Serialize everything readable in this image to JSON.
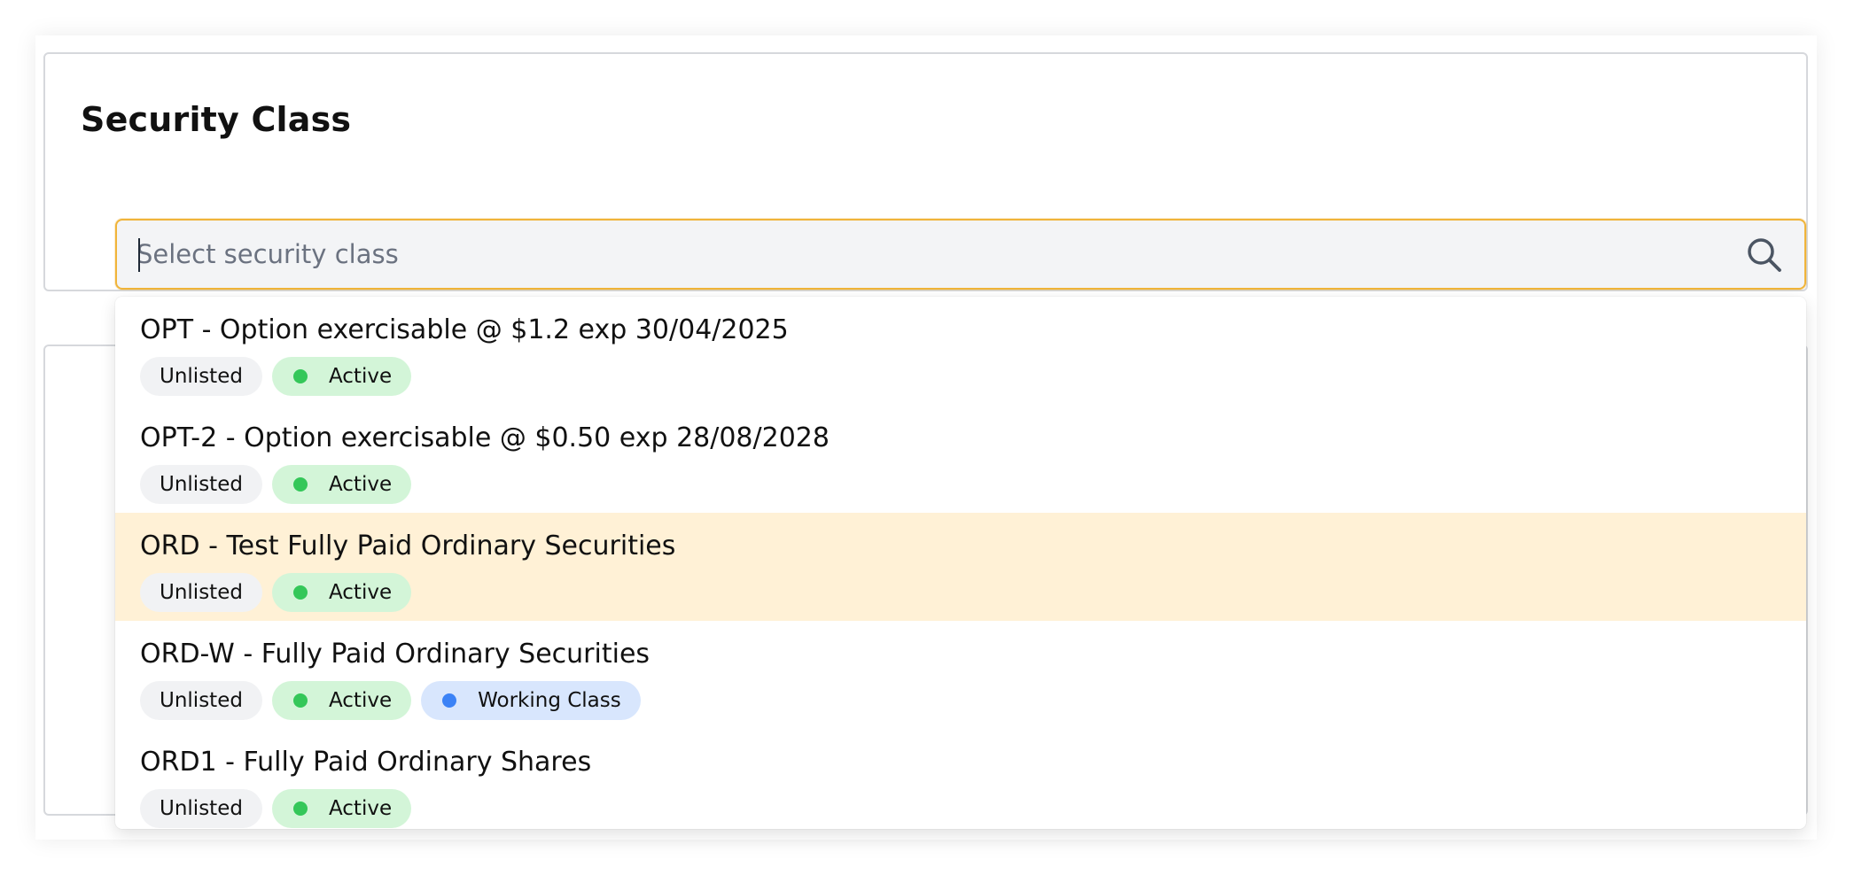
{
  "section": {
    "title": "Security Class"
  },
  "search": {
    "placeholder": "Select security class",
    "value": ""
  },
  "colors": {
    "focus_border": "#f0b43a",
    "highlight_row": "#fff1d6",
    "active_badge_bg": "#d3f5d8",
    "active_dot": "#34c759",
    "working_badge_bg": "#d8e6fd",
    "working_dot": "#3b82f6",
    "neutral_badge_bg": "#f1f2f4"
  },
  "options": [
    {
      "label": "OPT - Option exercisable @ $1.2 exp 30/04/2025",
      "listing": "Unlisted",
      "status": "Active"
    },
    {
      "label": "OPT-2 - Option exercisable @ $0.50 exp 28/08/2028",
      "listing": "Unlisted",
      "status": "Active"
    },
    {
      "label": "ORD - Test Fully Paid Ordinary Securities",
      "listing": "Unlisted",
      "status": "Active",
      "highlighted": true
    },
    {
      "label": "ORD-W - Fully Paid Ordinary Securities",
      "listing": "Unlisted",
      "status": "Active",
      "extra": "Working Class"
    },
    {
      "label": "ORD1 - Fully Paid Ordinary Shares",
      "listing": "Unlisted",
      "status": "Active"
    }
  ]
}
